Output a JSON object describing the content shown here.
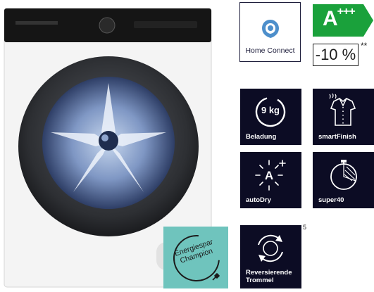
{
  "badges": {
    "home_connect": {
      "label": "Home Connect",
      "icon": "home-connect-icon"
    },
    "energy": {
      "class_letter": "A",
      "class_plus": "+++",
      "color": "#1aa13b",
      "saving": "-10 %",
      "saving_note": "**"
    },
    "champion": {
      "line1": "Energiespar",
      "line2": "Champion",
      "color": "#6fc4bd"
    }
  },
  "features": {
    "load": {
      "value": "9 kg",
      "label": "Beladung"
    },
    "smartfinish": {
      "label": "smartFinish"
    },
    "autodry": {
      "label": "autoDry"
    },
    "super40": {
      "label": "super40"
    },
    "reversing": {
      "label_line1": "Reversierende",
      "label_line2": "Trommel",
      "note": "5"
    }
  },
  "colors": {
    "tile_bg": "#0c0c24",
    "text_dark": "#1c1c3a"
  }
}
